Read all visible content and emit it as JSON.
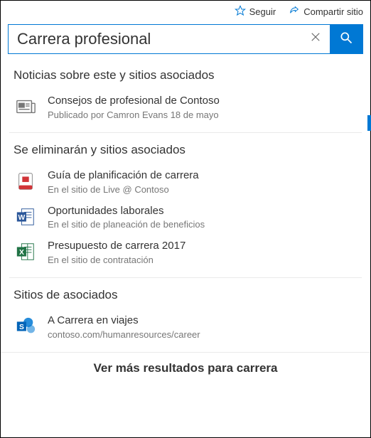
{
  "topbar": {
    "follow_label": "Seguir",
    "share_label": "Compartir sitio"
  },
  "search": {
    "value": "Carrera profesional",
    "placeholder": ""
  },
  "sections": {
    "news": {
      "title": "Noticias sobre este y sitios asociados",
      "items": [
        {
          "icon": "news-icon",
          "title": "Consejos de profesional de Contoso",
          "sub": "Publicado por Camron Evans 18 de mayo"
        }
      ]
    },
    "files": {
      "title": "Se eliminarán y sitios asociados",
      "items": [
        {
          "icon": "file-generic-icon",
          "title": "Guía de planificación de carrera",
          "sub": "En el sitio de Live @ Contoso"
        },
        {
          "icon": "word-icon",
          "title": "Oportunidades laborales",
          "sub": "En el sitio de planeación de beneficios"
        },
        {
          "icon": "excel-icon",
          "title": "Presupuesto de carrera 2017",
          "sub": "En el sitio de contratación"
        }
      ]
    },
    "sites": {
      "title": "Sitios de asociados",
      "items": [
        {
          "icon": "sharepoint-icon",
          "prefix": "A ",
          "title": "Carrera en viajes",
          "sub": "contoso.com/humanresources/career"
        }
      ]
    }
  },
  "more_label": "Ver más resultados para carrera"
}
